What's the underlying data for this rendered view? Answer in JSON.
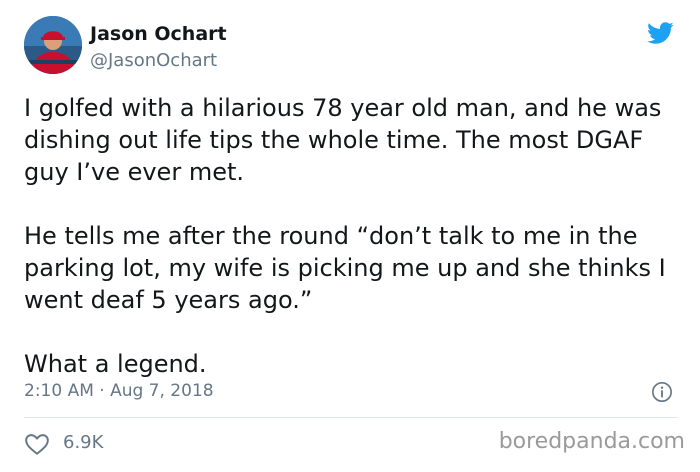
{
  "author": {
    "display_name": "Jason Ochart",
    "handle": "@JasonOchart"
  },
  "tweet": {
    "paragraphs": [
      "I golfed with a hilarious 78 year old man, and he was dishing out life tips the whole time. The most DGAF guy I’ve ever met.",
      "He tells me after the round “don’t talk to me in the parking lot, my wife is picking me up and she thinks I went deaf 5 years ago.”",
      "What a legend."
    ],
    "timestamp": "2:10 AM · Aug 7, 2018",
    "like_count": "6.9K"
  },
  "watermark": "boredpanda.com",
  "icons": {
    "brand": "twitter-bird-icon",
    "info": "info-icon",
    "like": "heart-icon"
  },
  "colors": {
    "twitter_blue": "#1da1f2",
    "secondary_text": "#657786",
    "primary_text": "#14171a"
  }
}
